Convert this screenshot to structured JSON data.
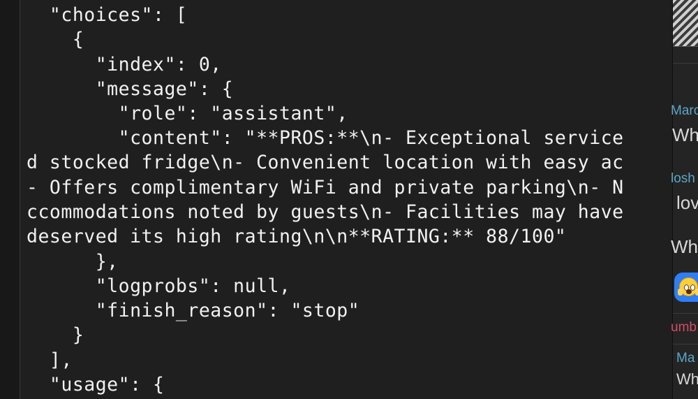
{
  "terminal": {
    "lines": [
      "  \"choices\": [",
      "    {",
      "      \"index\": 0,",
      "      \"message\": {",
      "        \"role\": \"assistant\",",
      "        \"content\": \"**PROS:**\\n- Exceptional service",
      "d stocked fridge\\n- Convenient location with easy ac",
      "- Offers complimentary WiFi and private parking\\n- N",
      "ccommodations noted by guests\\n- Facilities may have",
      "deserved its high rating\\n\\n**RATING:** 88/100\"",
      "      },",
      "      \"logprobs\": null,",
      "      \"finish_reason\": \"stop\"",
      "    }",
      "  ],",
      "  \"usage\": {"
    ]
  },
  "chat_panel": {
    "sender_1": "Marc",
    "message_1": "Wh",
    "sender_2": "losh",
    "message_2": "lov",
    "message_3": "Wh",
    "reaction_emoji": "face-screaming-in-fear-icon",
    "sender_3": "umb",
    "sender_4": "Ma",
    "message_4": "Wh"
  },
  "colors": {
    "terminal_bg": "#1f1f1f",
    "terminal_text": "#f1f1f1",
    "panel_bg": "#242424",
    "sender_blue": "#5aa7c8",
    "sender_red": "#d14c66",
    "reaction_bubble": "#2f7ef5"
  }
}
